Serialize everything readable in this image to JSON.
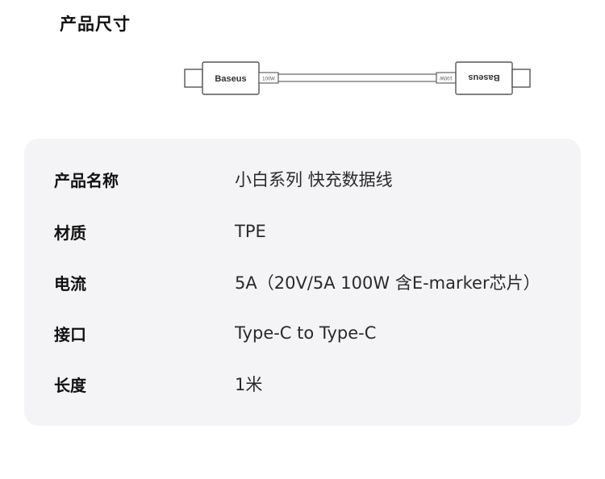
{
  "header": {
    "title": "产品尺寸"
  },
  "cable": {
    "left_brand": "Baseus",
    "left_rating": "100W",
    "right_brand": "Baseus",
    "right_rating": "100W"
  },
  "specs": [
    {
      "label": "产品名称",
      "value": "小白系列 快充数据线"
    },
    {
      "label": "材质",
      "value": "TPE"
    },
    {
      "label": "电流",
      "value": "5A（20V/5A 100W 含E-marker芯片）"
    },
    {
      "label": "接口",
      "value": "Type-C to Type-C"
    },
    {
      "label": "长度",
      "value": "1米"
    }
  ]
}
